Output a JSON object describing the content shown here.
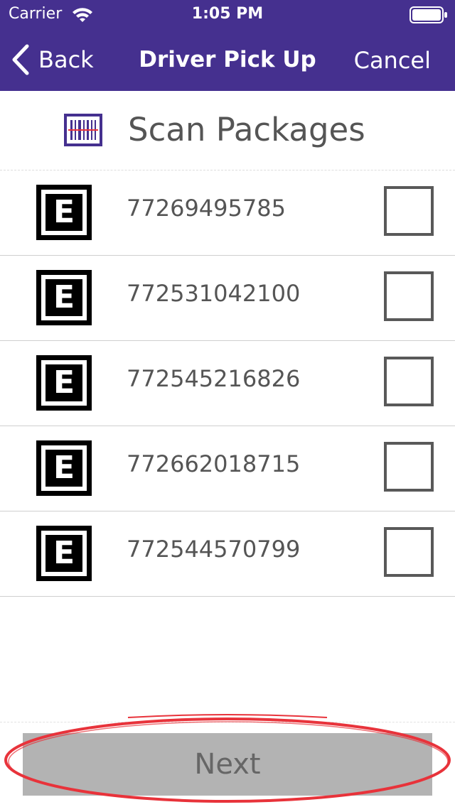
{
  "status_bar": {
    "carrier": "Carrier",
    "time": "1:05 PM",
    "wifi_icon": "wifi-icon",
    "battery_icon": "battery-icon"
  },
  "nav": {
    "back_label": "Back",
    "title": "Driver Pick Up",
    "cancel_label": "Cancel",
    "back_icon": "chevron-left-icon",
    "bar_color": "#45308f"
  },
  "header": {
    "icon": "barcode-scanner-icon",
    "title": "Scan Packages",
    "icon_color": "#45308f"
  },
  "packages": [
    {
      "icon_letter": "E",
      "tracking_number": "77269495785",
      "checked": false
    },
    {
      "icon_letter": "E",
      "tracking_number": "772531042100",
      "checked": false
    },
    {
      "icon_letter": "E",
      "tracking_number": "772545216826",
      "checked": false
    },
    {
      "icon_letter": "E",
      "tracking_number": "772662018715",
      "checked": false
    },
    {
      "icon_letter": "E",
      "tracking_number": "772544570799",
      "checked": false
    }
  ],
  "footer": {
    "next_label": "Next",
    "button_color": "#b3b3b3",
    "highlight_color": "#e8333b"
  }
}
